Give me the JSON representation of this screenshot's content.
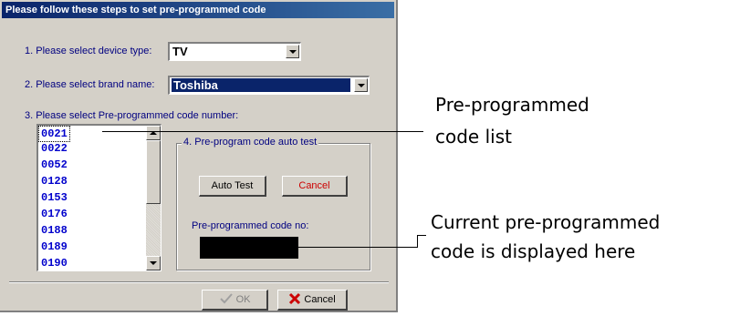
{
  "dialog": {
    "title": "Please follow these steps to set pre-programmed code",
    "step1": {
      "label": "1. Please select device type:",
      "value": "TV"
    },
    "step2": {
      "label": "2. Please select brand name:",
      "value": "Toshiba"
    },
    "step3": {
      "label": "3. Please select Pre-programmed code number:",
      "codes": [
        "0021",
        "0022",
        "0052",
        "0128",
        "0153",
        "0176",
        "0188",
        "0189",
        "0190"
      ]
    },
    "step4": {
      "group_title": "4. Pre-program code auto test",
      "auto_test_label": "Auto Test",
      "cancel_label": "Cancel",
      "code_no_label": "Pre-programmed code no:",
      "code_no_value": ""
    },
    "footer": {
      "ok_label": "OK",
      "cancel_label": "Cancel"
    }
  },
  "annotations": {
    "code_list": [
      "Pre-programmed",
      "code list"
    ],
    "current_code": [
      "Current pre-programmed",
      "code is displayed here"
    ]
  },
  "colors": {
    "dialog_bg": "#d4d0c8",
    "title_bar": "#0a246a",
    "label_text": "#000080",
    "code_text": "#0000cc",
    "selection": "#0a246a",
    "cancel_icon": "#cc0000"
  },
  "icons": [
    "dropdown-arrow-icon",
    "scroll-up-icon",
    "scroll-down-icon",
    "checkmark-icon",
    "x-icon"
  ]
}
